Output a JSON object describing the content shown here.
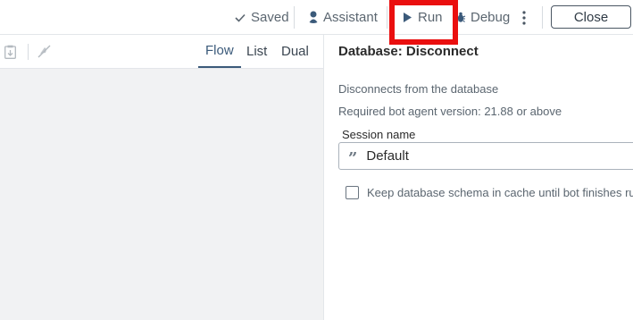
{
  "toolbar": {
    "saved_label": "Saved",
    "assistant_label": "Assistant",
    "run_label": "Run",
    "debug_label": "Debug",
    "close_label": "Close",
    "icons": {
      "saved": "check-icon",
      "assistant": "assistant-icon",
      "run": "play-icon",
      "debug": "bug-icon",
      "more": "more-vertical-icon"
    },
    "highlight_color": "#ea0f0f"
  },
  "canvas_toolbar": {
    "icons": [
      "clipboard-download-icon",
      "disabled-feature-icon"
    ],
    "view_tabs": [
      {
        "label": "Flow",
        "active": true
      },
      {
        "label": "List",
        "active": false
      },
      {
        "label": "Dual",
        "active": false
      }
    ]
  },
  "panel": {
    "title": "Database: Disconnect",
    "description": "Disconnects from the database",
    "version": "Required bot agent version: 21.88 or above",
    "session": {
      "label": "Session name",
      "value": "Default",
      "icon": "quote-icon"
    },
    "checkbox": {
      "label": "Keep database schema in cache until bot finishes runni",
      "checked": false
    }
  },
  "colors": {
    "accent": "#3b5a7a",
    "canvas_bg": "#f1f2f3",
    "highlight": "#ea0f0f"
  }
}
